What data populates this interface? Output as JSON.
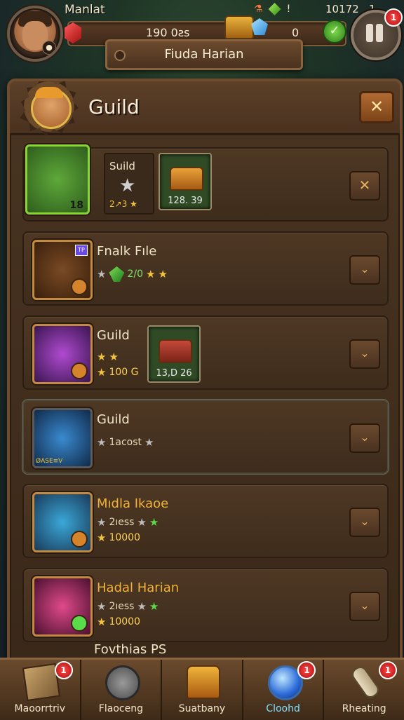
{
  "hud": {
    "player_name": "Manlat",
    "currency_1": "190 0ƨs",
    "currency_2": "0",
    "energy": "10172",
    "energy_2": "1",
    "pause_badge": "1",
    "area_title": "Fiuda Harian"
  },
  "panel": {
    "title": "Guild",
    "close_label": "✕"
  },
  "rows": [
    {
      "title": "Suild",
      "icon_number": "18",
      "stars_text": "2↗3 ★",
      "reward_caption": "128. 39",
      "button": "✕"
    },
    {
      "title": "Fnalk Fıle",
      "value": "2/0",
      "button": "⌄"
    },
    {
      "title": "Guild",
      "value": "100 G",
      "reward_caption": "13,D 26",
      "button": "⌄"
    },
    {
      "title": "Guild",
      "value": "1acost",
      "icon_caption": "ØASE≡V",
      "button": "⌄"
    },
    {
      "title": "Mıdla Ikaoe",
      "value_1": "2ıess",
      "value_2": "10000",
      "button": "⌄"
    },
    {
      "title": "Hadal Harian",
      "value_1": "2ıess",
      "value_2": "10000",
      "button": "⌄"
    }
  ],
  "peek_row_title": "Fovthias PS",
  "nav": [
    {
      "label": "Maoorrtriv",
      "badge": "1",
      "icon": "map-icon"
    },
    {
      "label": "Flaoceng",
      "badge": "",
      "icon": "search-icon"
    },
    {
      "label": "Suatbany",
      "badge": "",
      "icon": "chest-icon"
    },
    {
      "label": "Cloohd",
      "badge": "1",
      "icon": "orb-icon"
    },
    {
      "label": "Rheating",
      "badge": "1",
      "icon": "scroll-icon"
    }
  ],
  "colors": {
    "panel": "#3e2c1c",
    "accent_gold": "#f1b13a",
    "highlight_green": "#8ad43a",
    "active_nav": "#7ee0ff"
  }
}
